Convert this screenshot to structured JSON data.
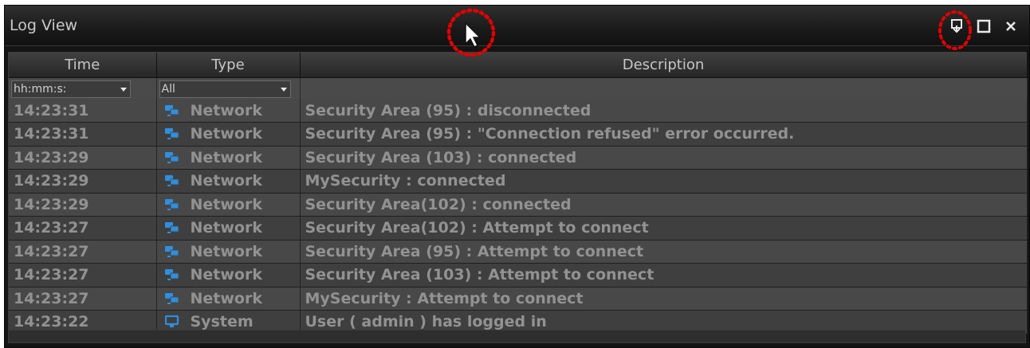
{
  "window": {
    "title": "Log View",
    "buttons": [
      "dock-icon",
      "maximize-icon",
      "close-icon"
    ]
  },
  "columns": [
    {
      "label": "Time"
    },
    {
      "label": "Type"
    },
    {
      "label": "Description"
    }
  ],
  "filters": {
    "time_value": "hh:mm:s:",
    "type_value": "All"
  },
  "rows": [
    {
      "time": "14:23:31",
      "type": "Network",
      "icon": "network-icon",
      "description": "Security Area (95) : disconnected"
    },
    {
      "time": "14:23:31",
      "type": "Network",
      "icon": "network-icon",
      "description": "Security Area (95) : \"Connection refused\" error occurred."
    },
    {
      "time": "14:23:29",
      "type": "Network",
      "icon": "network-icon",
      "description": "Security Area (103) : connected"
    },
    {
      "time": "14:23:29",
      "type": "Network",
      "icon": "network-icon",
      "description": "MySecurity : connected"
    },
    {
      "time": "14:23:29",
      "type": "Network",
      "icon": "network-icon",
      "description": "Security Area(102) : connected"
    },
    {
      "time": "14:23:27",
      "type": "Network",
      "icon": "network-icon",
      "description": "Security Area(102) : Attempt to connect"
    },
    {
      "time": "14:23:27",
      "type": "Network",
      "icon": "network-icon",
      "description": "Security Area (95) : Attempt to connect"
    },
    {
      "time": "14:23:27",
      "type": "Network",
      "icon": "network-icon",
      "description": "Security Area (103) : Attempt to connect"
    },
    {
      "time": "14:23:27",
      "type": "Network",
      "icon": "network-icon",
      "description": "MySecurity : Attempt to connect"
    },
    {
      "time": "14:23:22",
      "type": "System",
      "icon": "system-icon",
      "description": "User ( admin ) has logged in"
    }
  ],
  "colors": {
    "background": "#141414",
    "row_text": "#929292",
    "icon_blue": "#2e8fe0",
    "highlight_marker": "#e00000"
  }
}
